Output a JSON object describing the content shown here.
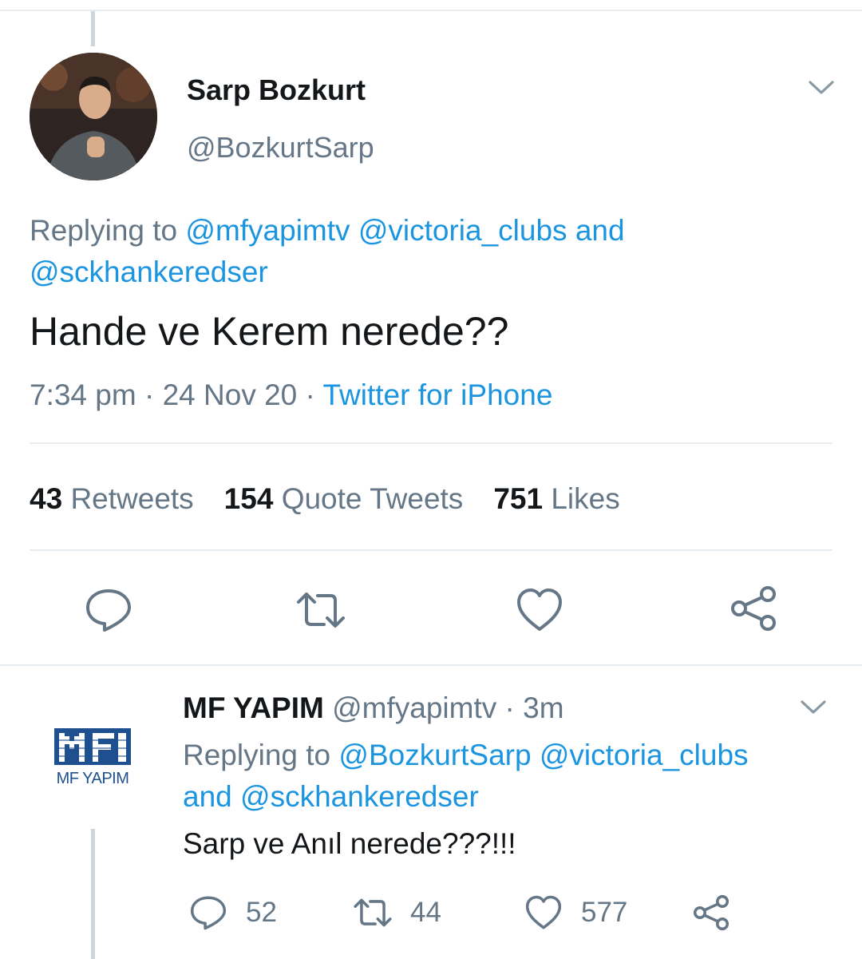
{
  "tweet": {
    "author_name": "Sarp Bozkurt",
    "author_handle": "@BozkurtSarp",
    "replying_prefix": "Replying to ",
    "replying_user1": "@mfyapimtv",
    "replying_user2": "@victoria_clubs",
    "replying_and": "and",
    "replying_user3": "@sckhankeredser",
    "text": "Hande ve Kerem nerede??",
    "time": "7:34 pm",
    "dot": " · ",
    "date": "24 Nov 20",
    "source": "Twitter for iPhone",
    "stats": {
      "retweets_count": "43",
      "retweets_label": "Retweets",
      "quotes_count": "154",
      "quotes_label": "Quote Tweets",
      "likes_count": "751",
      "likes_label": "Likes"
    },
    "icons": [
      "reply-icon",
      "retweet-icon",
      "like-icon",
      "share-icon",
      "chevron-down-icon"
    ]
  },
  "reply": {
    "author_name": "MF YAPIM",
    "author_handle": "@mfyapimtv",
    "time_ago": "3m",
    "logo_text": "MF YAPIM",
    "replying_prefix": "Replying to ",
    "replying_user1": "@BozkurtSarp",
    "replying_user2": "@victoria_clubs",
    "replying_and": "and",
    "replying_user3": "@sckhankeredser",
    "text": "Sarp ve Anıl nerede???!!!",
    "reply_count": "52",
    "retweet_count": "44",
    "like_count": "577"
  },
  "colors": {
    "link": "#1b95e0",
    "muted": "#657786",
    "text": "#14171a",
    "divider": "#e6ecf0",
    "thread_line": "#ccd6dd",
    "logo": "#1e4f8f"
  }
}
